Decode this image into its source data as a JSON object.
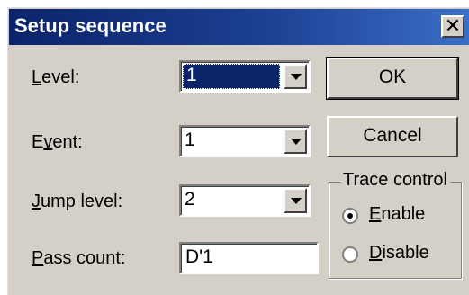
{
  "window": {
    "title": "Setup sequence"
  },
  "form": {
    "level_label_key": "L",
    "level_label_rest": "evel:",
    "level_value": "1",
    "event_label_pre": "E",
    "event_label_key": "v",
    "event_label_rest": "ent:",
    "event_value": "1",
    "jump_label_key": "J",
    "jump_label_rest": "ump level:",
    "jump_value": "2",
    "pass_label_key": "P",
    "pass_label_rest": "ass count:",
    "pass_value": "D'1"
  },
  "buttons": {
    "ok": "OK",
    "cancel": "Cancel"
  },
  "trace": {
    "title": "Trace control",
    "enable_key": "E",
    "enable_rest": "nable",
    "disable_key": "D",
    "disable_rest": "isable",
    "selected": "Enable"
  },
  "icons": {
    "close": "close-icon",
    "dropdown": "dropdown-arrow-icon"
  }
}
